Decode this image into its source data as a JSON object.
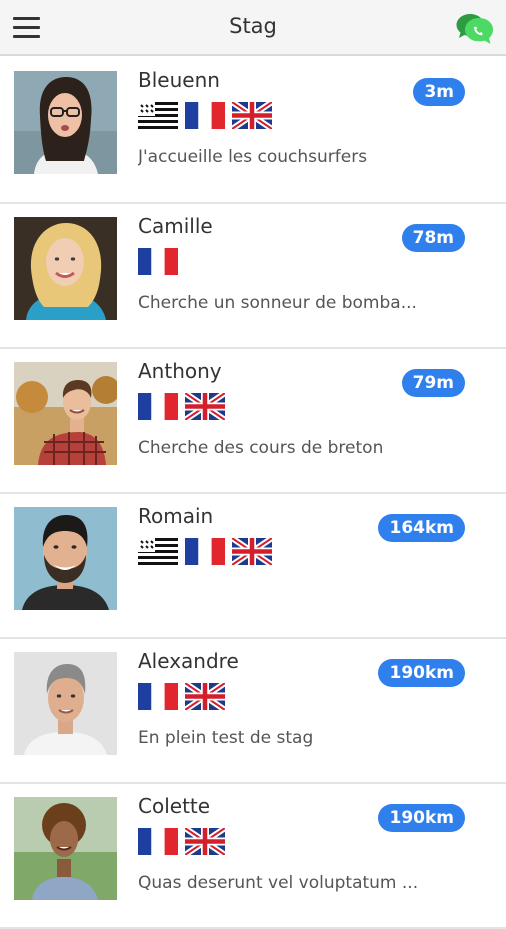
{
  "app": {
    "title": "Stag",
    "accent_color": "#2f80ed",
    "chat_color": "#4caf50"
  },
  "header": {
    "menu_icon": "hamburger-menu-icon",
    "chat_icon": "chat-bubbles-icon"
  },
  "users": [
    {
      "name": "Bleuenn",
      "distance": "3m",
      "flags": [
        "breton",
        "france",
        "uk"
      ],
      "message": "J'accueille les couchsurfers",
      "avatar": "woman-glasses-dark-hair"
    },
    {
      "name": "Camille",
      "distance": "78m",
      "flags": [
        "france"
      ],
      "message": "Cherche un sonneur de bomba...",
      "avatar": "woman-blonde-curly"
    },
    {
      "name": "Anthony",
      "distance": "79m",
      "flags": [
        "france",
        "uk"
      ],
      "message": "Cherche des cours de breton",
      "avatar": "man-plaid-shirt"
    },
    {
      "name": "Romain",
      "distance": "164km",
      "flags": [
        "breton",
        "france",
        "uk"
      ],
      "message": "",
      "avatar": "man-beard-smiling"
    },
    {
      "name": "Alexandre",
      "distance": "190km",
      "flags": [
        "france",
        "uk"
      ],
      "message": "En plein test de stag",
      "avatar": "man-grey-hair"
    },
    {
      "name": "Colette",
      "distance": "190km",
      "flags": [
        "france",
        "uk"
      ],
      "message": "Quas deserunt vel voluptatum ...",
      "avatar": "woman-curly-hair-outdoor"
    }
  ]
}
